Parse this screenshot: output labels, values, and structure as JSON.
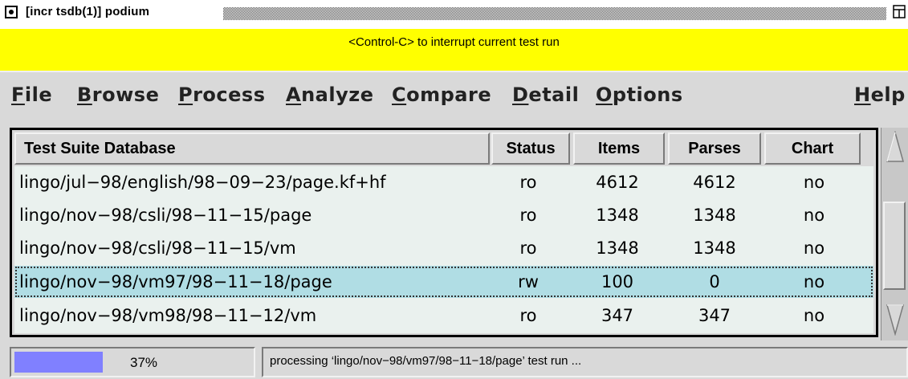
{
  "window": {
    "title": "[incr tsdb(1)] podium",
    "maximize_icon": "maximize-icon",
    "menu_button_icon": "window-menu-icon"
  },
  "banner": {
    "text": "<Control-C> to interrupt current test run",
    "color": "#ffff00"
  },
  "menu": {
    "items": [
      {
        "first": "F",
        "rest": "ile"
      },
      {
        "first": "B",
        "rest": "rowse"
      },
      {
        "first": "P",
        "rest": "rocess"
      },
      {
        "first": "A",
        "rest": "nalyze"
      },
      {
        "first": "C",
        "rest": "ompare"
      },
      {
        "first": "D",
        "rest": "etail"
      },
      {
        "first": "O",
        "rest": "ptions"
      }
    ],
    "help": {
      "first": "H",
      "rest": "elp"
    }
  },
  "table": {
    "headers": [
      "Test Suite Database",
      "Status",
      "Items",
      "Parses",
      "Chart"
    ],
    "rows": [
      {
        "name": "lingo/jul−98/english/98−09−23/page.kf+hf",
        "status": "ro",
        "items": "4612",
        "parses": "4612",
        "chart": "no"
      },
      {
        "name": "lingo/nov−98/csli/98−11−15/page",
        "status": "ro",
        "items": "1348",
        "parses": "1348",
        "chart": "no"
      },
      {
        "name": "lingo/nov−98/csli/98−11−15/vm",
        "status": "ro",
        "items": "1348",
        "parses": "1348",
        "chart": "no"
      },
      {
        "name": "lingo/nov−98/vm97/98−11−18/page",
        "status": "rw",
        "items": "100",
        "parses": "0",
        "chart": "no"
      },
      {
        "name": "lingo/nov−98/vm98/98−11−12/vm",
        "status": "ro",
        "items": "347",
        "parses": "347",
        "chart": "no"
      }
    ],
    "selected_row": 3,
    "selected_color": "#b0dde4"
  },
  "status": {
    "progress_text": "37%",
    "progress_fraction": 0.37,
    "progress_color": "#8080ff",
    "message": "processing ‘lingo/nov−98/vm97/98−11−18/page’ test run ..."
  }
}
